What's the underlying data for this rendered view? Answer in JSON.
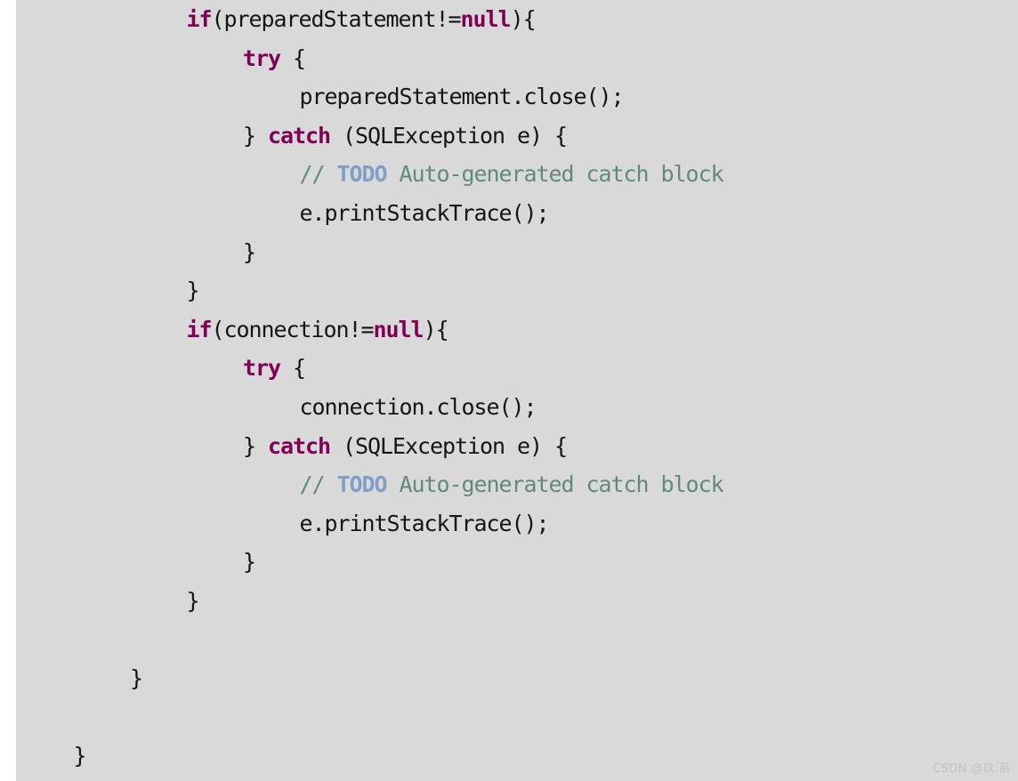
{
  "document": {
    "kind": "code-snippet",
    "language": "Java",
    "background_color": "#d9d9d9",
    "page_background_color": "#ffffff",
    "text_color": "#151515",
    "keyword_color": "#7f0055",
    "comment_color": "#5f8a7d",
    "todo_color": "#7fa0c4"
  },
  "code": {
    "lines": [
      {
        "indent": 3,
        "tokens": [
          {
            "type": "keyword",
            "text": "if"
          },
          {
            "type": "plain",
            "text": "(preparedStatement!="
          },
          {
            "type": "keyword",
            "text": "null"
          },
          {
            "type": "plain",
            "text": "){"
          }
        ]
      },
      {
        "indent": 4,
        "tokens": [
          {
            "type": "keyword",
            "text": "try"
          },
          {
            "type": "plain",
            "text": " {"
          }
        ]
      },
      {
        "indent": 5,
        "tokens": [
          {
            "type": "plain",
            "text": "preparedStatement.close();"
          }
        ]
      },
      {
        "indent": 4,
        "tokens": [
          {
            "type": "plain",
            "text": "} "
          },
          {
            "type": "keyword",
            "text": "catch"
          },
          {
            "type": "plain",
            "text": " (SQLException e) {"
          }
        ]
      },
      {
        "indent": 5,
        "tokens": [
          {
            "type": "comment",
            "text": "// "
          },
          {
            "type": "todo",
            "text": "TODO"
          },
          {
            "type": "comment",
            "text": " Auto-generated catch block"
          }
        ]
      },
      {
        "indent": 5,
        "tokens": [
          {
            "type": "plain",
            "text": "e.printStackTrace();"
          }
        ]
      },
      {
        "indent": 4,
        "tokens": [
          {
            "type": "plain",
            "text": "}"
          }
        ]
      },
      {
        "indent": 3,
        "tokens": [
          {
            "type": "plain",
            "text": "}"
          }
        ]
      },
      {
        "indent": 3,
        "tokens": [
          {
            "type": "keyword",
            "text": "if"
          },
          {
            "type": "plain",
            "text": "(connection!="
          },
          {
            "type": "keyword",
            "text": "null"
          },
          {
            "type": "plain",
            "text": "){"
          }
        ]
      },
      {
        "indent": 4,
        "tokens": [
          {
            "type": "keyword",
            "text": "try"
          },
          {
            "type": "plain",
            "text": " {"
          }
        ]
      },
      {
        "indent": 5,
        "tokens": [
          {
            "type": "plain",
            "text": "connection.close();"
          }
        ]
      },
      {
        "indent": 4,
        "tokens": [
          {
            "type": "plain",
            "text": "} "
          },
          {
            "type": "keyword",
            "text": "catch"
          },
          {
            "type": "plain",
            "text": " (SQLException e) {"
          }
        ]
      },
      {
        "indent": 5,
        "tokens": [
          {
            "type": "comment",
            "text": "// "
          },
          {
            "type": "todo",
            "text": "TODO"
          },
          {
            "type": "comment",
            "text": " Auto-generated catch block"
          }
        ]
      },
      {
        "indent": 5,
        "tokens": [
          {
            "type": "plain",
            "text": "e.printStackTrace();"
          }
        ]
      },
      {
        "indent": 4,
        "tokens": [
          {
            "type": "plain",
            "text": "}"
          }
        ]
      },
      {
        "indent": 3,
        "tokens": [
          {
            "type": "plain",
            "text": "}"
          }
        ]
      },
      {
        "indent": 0,
        "tokens": []
      },
      {
        "indent": 2,
        "tokens": [
          {
            "type": "plain",
            "text": "}"
          }
        ]
      },
      {
        "indent": 0,
        "tokens": []
      },
      {
        "indent": 1,
        "tokens": [
          {
            "type": "plain",
            "text": "}"
          }
        ]
      }
    ]
  },
  "watermark": {
    "text": "CSDN @玖.萵"
  }
}
